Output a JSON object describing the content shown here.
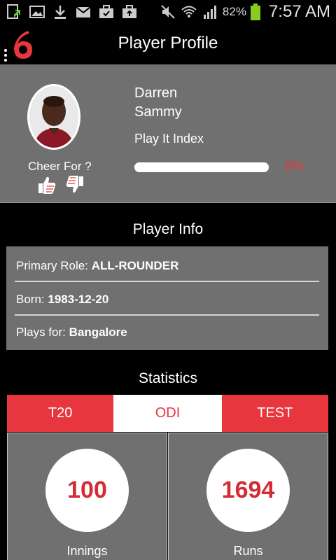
{
  "status_bar": {
    "battery_percent": "82%",
    "time": "7:57 AM",
    "icons": [
      "upload-notification-icon",
      "gallery-icon",
      "download-icon",
      "gmail-icon",
      "briefcase-check-icon",
      "briefcase-upload-icon",
      "mute-icon",
      "wifi-icon",
      "signal-icon",
      "battery-icon"
    ]
  },
  "header": {
    "title": "Player Profile",
    "logo_icon": "six-logo-icon",
    "menu_icon": "overflow-menu-icon"
  },
  "profile": {
    "name": "Darren\nSammy",
    "play_it_index_label": "Play It Index",
    "play_it_index_value": "0%",
    "play_it_index_fraction": 0,
    "cheer_label": "Cheer For ?"
  },
  "player_info": {
    "section_title": "Player Info",
    "primary_role_label": "Primary Role:",
    "primary_role_value": "ALL-ROUNDER",
    "born_label": "Born:",
    "born_value": "1983-12-20",
    "plays_for_label": "Plays for:",
    "plays_for_value": "Bangalore"
  },
  "statistics": {
    "section_title": "Statistics",
    "tabs": [
      {
        "label": "T20",
        "active": false
      },
      {
        "label": "ODI",
        "active": true
      },
      {
        "label": "TEST",
        "active": false
      }
    ],
    "cards": [
      {
        "value": "100",
        "label": "Innings"
      },
      {
        "value": "1694",
        "label": "Runs"
      }
    ]
  },
  "colors": {
    "accent": "#e8363f",
    "panel": "#707070",
    "background": "#000000"
  }
}
